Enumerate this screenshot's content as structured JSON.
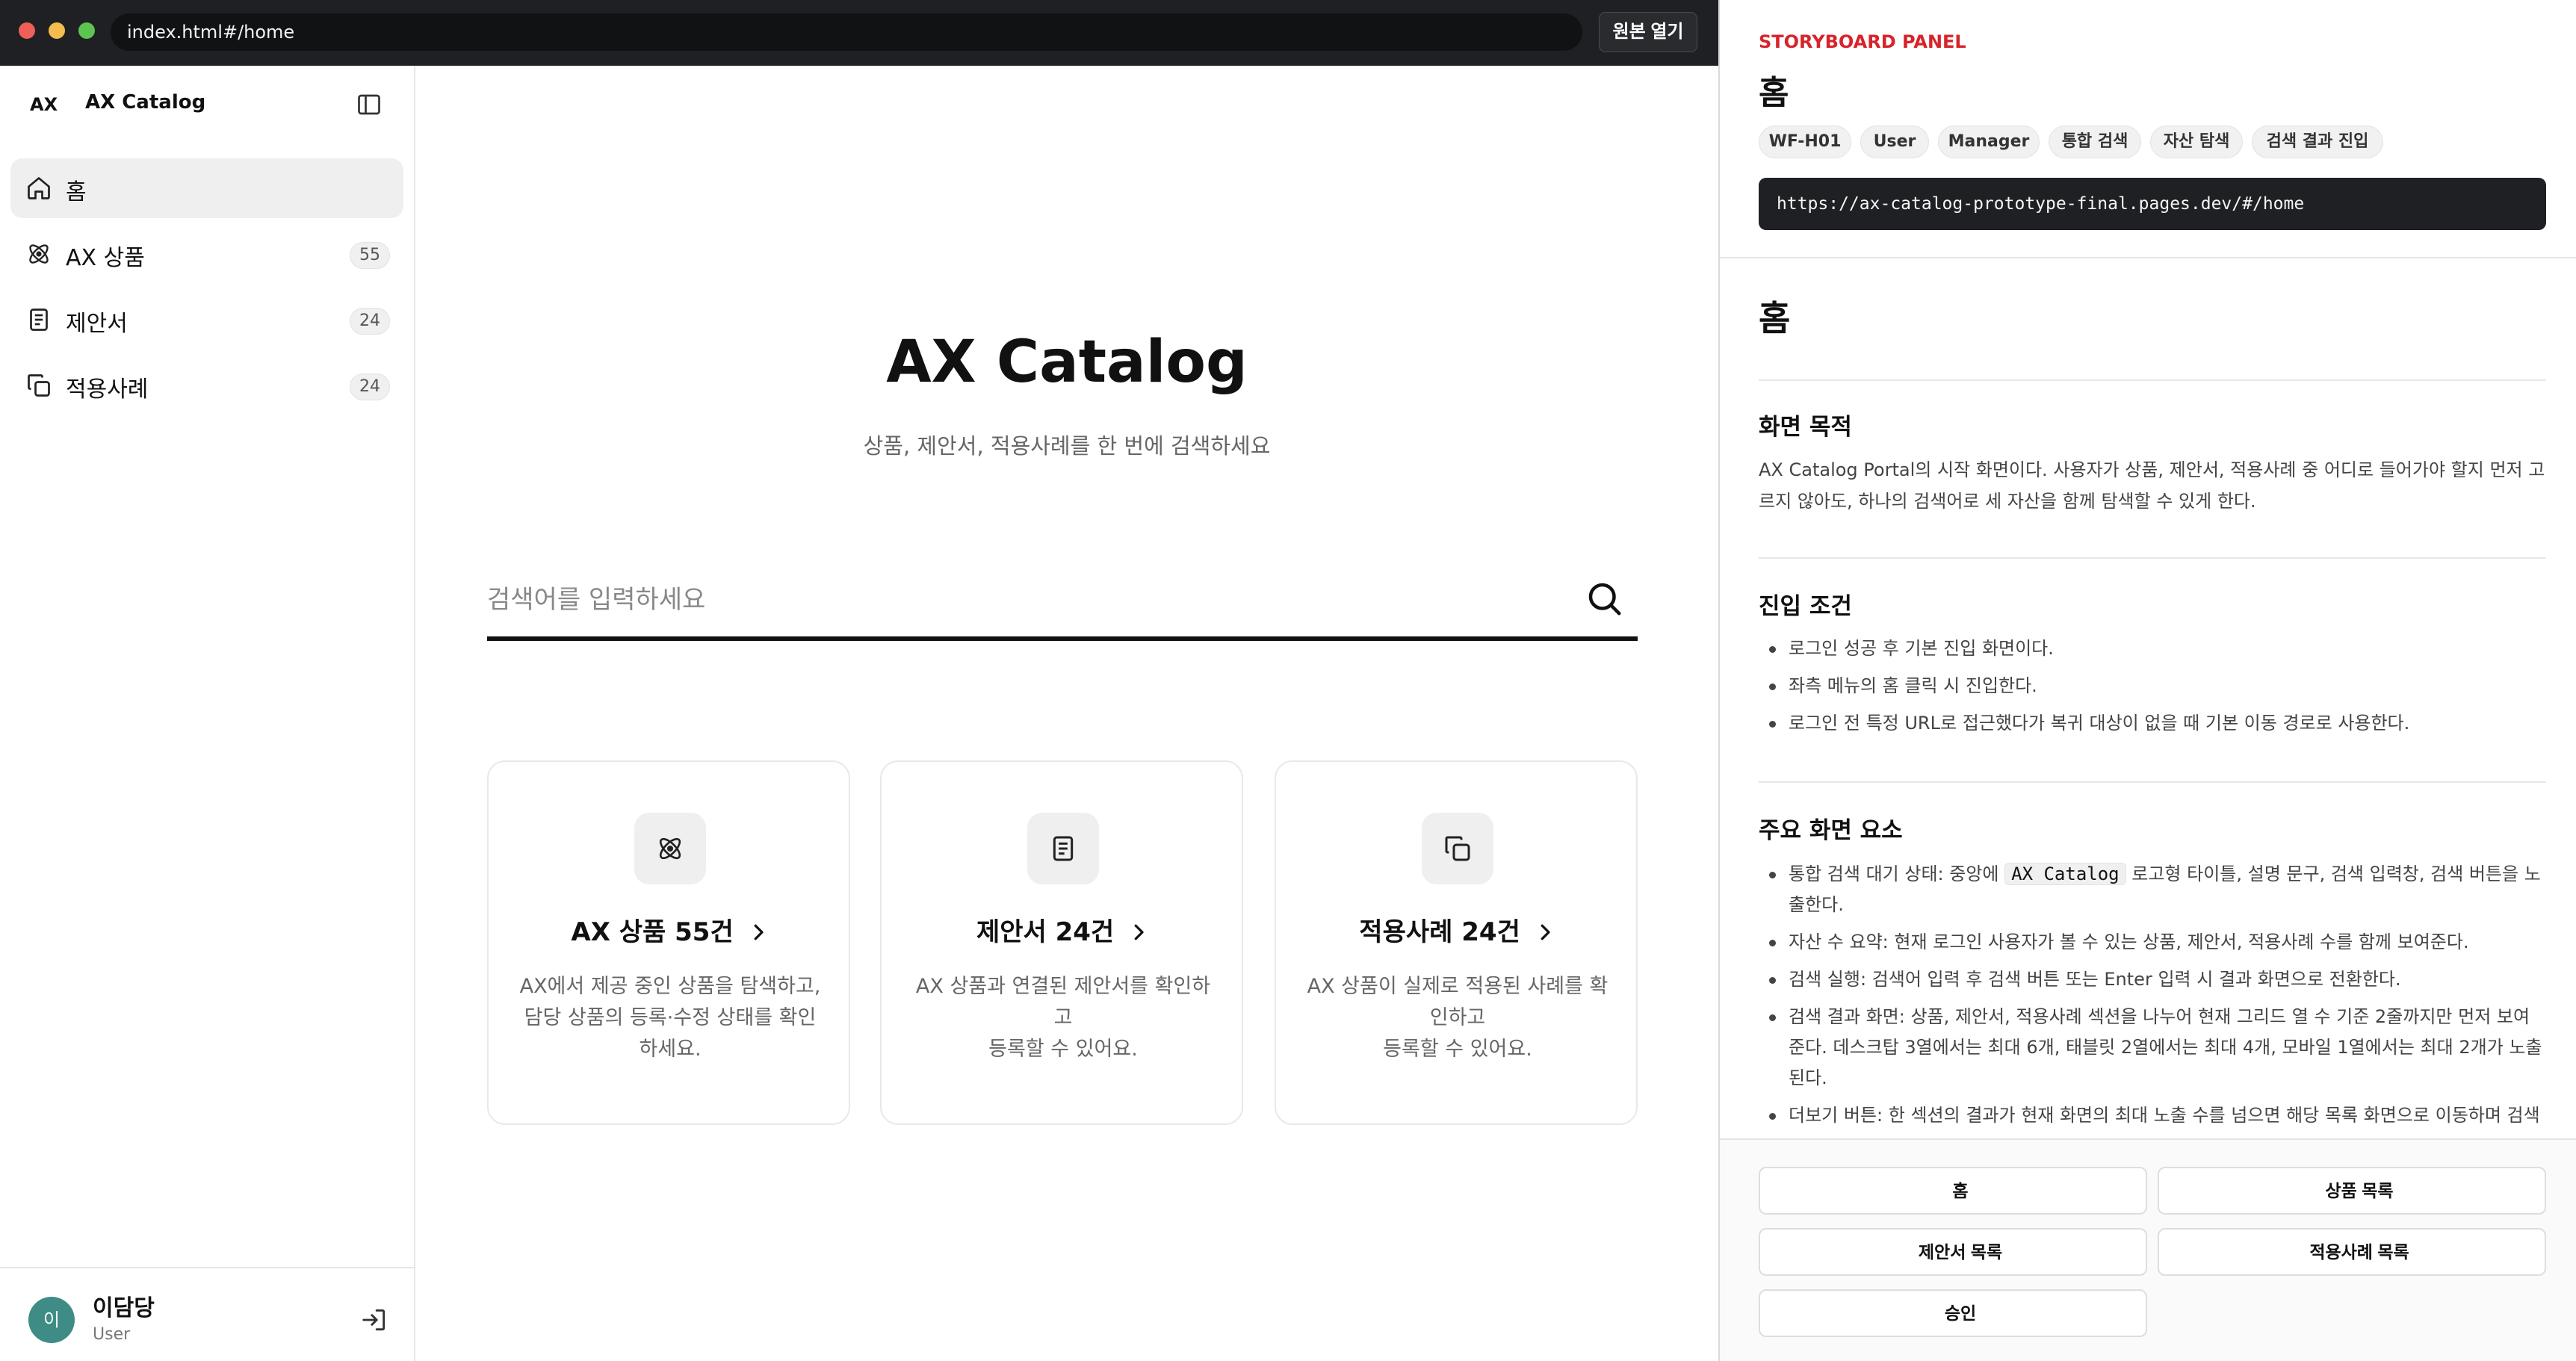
{
  "browser": {
    "url": "index.html#/home",
    "open_original_label": "원본 열기"
  },
  "sidebar": {
    "brand_mark": "AX",
    "brand_name": "AX Catalog",
    "items": [
      {
        "label": "홈",
        "icon": "home-icon",
        "count": ""
      },
      {
        "label": "AX 상품",
        "icon": "atom-icon",
        "count": "55"
      },
      {
        "label": "제안서",
        "icon": "document-icon",
        "count": "24"
      },
      {
        "label": "적용사례",
        "icon": "copy-icon",
        "count": "24"
      }
    ],
    "user": {
      "avatar_initial": "이",
      "name": "이담당",
      "role": "User"
    }
  },
  "main": {
    "title": "AX Catalog",
    "subtitle": "상품, 제안서, 적용사례를 한 번에 검색하세요",
    "search_placeholder": "검색어를 입력하세요",
    "cards": [
      {
        "title": "AX 상품 55건",
        "description": "AX에서 제공 중인 상품을 탐색하고,\n담당 상품의 등록·수정 상태를 확인\n하세요.",
        "icon": "atom-icon"
      },
      {
        "title": "제안서 24건",
        "description": "AX 상품과 연결된 제안서를 확인하\n고\n등록할 수 있어요.",
        "icon": "document-icon"
      },
      {
        "title": "적용사례 24건",
        "description": "AX 상품이 실제로 적용된 사례를 확\n인하고\n등록할 수 있어요.",
        "icon": "copy-icon"
      }
    ]
  },
  "panel": {
    "eyebrow": "STORYBOARD PANEL",
    "title": "홈",
    "tags": [
      "WF-H01",
      "User",
      "Manager",
      "통합 검색",
      "자산 탐색",
      "검색 결과 진입"
    ],
    "url": "https://ax-catalog-prototype-final.pages.dev/#/home",
    "doc_title": "홈",
    "sections": {
      "purpose": {
        "title": "화면 목적",
        "text": "AX Catalog Portal의 시작 화면이다. 사용자가 상품, 제안서, 적용사례 중 어디로 들어가야 할지 먼저 고르지 않아도, 하나의 검색어로 세 자산을 함께 탐색할 수 있게 한다."
      },
      "entry": {
        "title": "진입 조건",
        "items": [
          "로그인 성공 후 기본 진입 화면이다.",
          "좌측 메뉴의 홈 클릭 시 진입한다.",
          "로그인 전 특정 URL로 접근했다가 복귀 대상이 없을 때 기본 이동 경로로 사용한다."
        ]
      },
      "elements": {
        "title": "주요 화면 요소",
        "item1_before": "통합 검색 대기 상태: 중앙에 ",
        "item1_code": "AX Catalog",
        "item1_after": " 로고형 타이틀, 설명 문구, 검색 입력창, 검색 버튼을 노출한다.",
        "items": [
          "자산 수 요약: 현재 로그인 사용자가 볼 수 있는 상품, 제안서, 적용사례 수를 함께 보여준다.",
          "검색 실행: 검색어 입력 후 검색 버튼 또는 Enter 입력 시 결과 화면으로 전환한다.",
          "검색 결과 화면: 상품, 제안서, 적용사례 섹션을 나누어 현재 그리드 열 수 기준 2줄까지만 먼저 보여준다. 데스크탑 3열에서는 최대 6개, 태블릿 2열에서는 최대 4개, 모바일 1열에서는 최대 2개가 노출된다.",
          "더보기 버튼: 한 섹션의 결과가 현재 화면의 최대 노출 수를 넘으면 해당 목록 화면으로 이동하며 검색"
        ]
      }
    },
    "shortcuts": [
      "홈",
      "상품 목록",
      "제안서 목록",
      "적용사례 목록",
      "승인"
    ]
  }
}
